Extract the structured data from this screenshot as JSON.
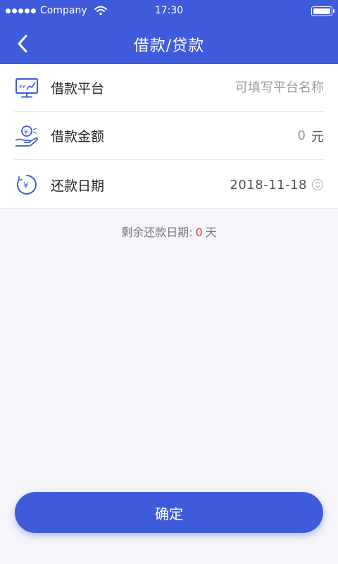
{
  "colors": {
    "primary": "#3f5bdc",
    "highlight": "#e23d2b",
    "background": "#f5f5fa"
  },
  "status_bar": {
    "carrier": "Company",
    "time": "17:30"
  },
  "nav": {
    "back_icon": "chevron-left-icon",
    "title": "借款/贷款"
  },
  "form": {
    "platform": {
      "icon": "monitor-chart-icon",
      "label": "借款平台",
      "placeholder": "可填写平台名称",
      "value": ""
    },
    "amount": {
      "icon": "hand-coin-icon",
      "label": "借款金额",
      "value": "0",
      "unit": "元"
    },
    "repay_date": {
      "icon": "yuan-clock-icon",
      "label": "还款日期",
      "value": "2018-11-18",
      "picker_icon": "chevron-circle-icon"
    }
  },
  "remaining": {
    "label": "剩余还款日期:",
    "days": "0",
    "unit": "天"
  },
  "confirm_button": {
    "label": "确定"
  }
}
